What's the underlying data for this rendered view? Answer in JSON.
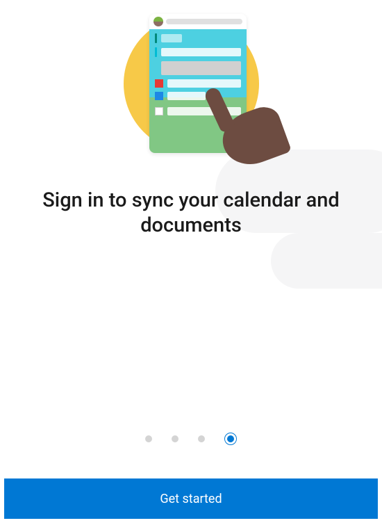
{
  "onboarding": {
    "heading": "Sign in to sync your calendar and documents",
    "cta_label": "Get started",
    "page_index": 3,
    "page_count": 4
  },
  "colors": {
    "primary": "#0078d4",
    "accent_yellow": "#f7c948"
  }
}
